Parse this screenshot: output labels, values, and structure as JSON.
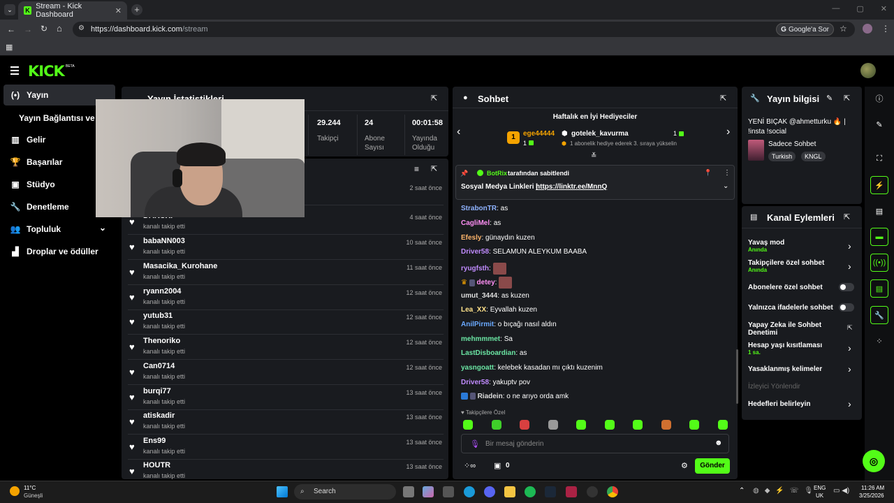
{
  "browser": {
    "tab_title": "Stream - Kick Dashboard",
    "url_host": "https://dashboard.kick.com",
    "url_path": "/stream",
    "google_label": "Google'a Sor"
  },
  "header": {
    "logo": "KICK",
    "beta": "BETA"
  },
  "sidebar": {
    "items": [
      {
        "label": "Yayın",
        "icon": "broadcast-icon"
      },
      {
        "label": "Yayın Bağlantısı ve Ar"
      },
      {
        "label": "Gelir",
        "icon": "chart-icon"
      },
      {
        "label": "Başarılar",
        "icon": "trophy-icon"
      },
      {
        "label": "Stüdyo",
        "icon": "studio-icon"
      },
      {
        "label": "Denetleme",
        "icon": "wrench-icon"
      },
      {
        "label": "Topluluk",
        "icon": "people-icon"
      },
      {
        "label": "Droplar ve ödüller",
        "icon": "gift-icon"
      }
    ]
  },
  "stats": {
    "title": "Yayın İstatistikleri",
    "items": [
      {
        "value": "29.244",
        "label": "Takipçi"
      },
      {
        "value": "24",
        "label": "Abone Sayısı"
      },
      {
        "value": "00:01:58",
        "label": "Yayında Olduğu"
      }
    ]
  },
  "followers": [
    {
      "name": "",
      "sub": "",
      "time": "2 saat önce"
    },
    {
      "name": "DAKUXI",
      "sub": "kanalı takip etti",
      "time": "4 saat önce"
    },
    {
      "name": "babaNN003",
      "sub": "kanalı takip etti",
      "time": "10 saat önce"
    },
    {
      "name": "Masacika_Kurohane",
      "sub": "kanalı takip etti",
      "time": "11 saat önce"
    },
    {
      "name": "ryann2004",
      "sub": "kanalı takip etti",
      "time": "12 saat önce"
    },
    {
      "name": "yutub31",
      "sub": "kanalı takip etti",
      "time": "12 saat önce"
    },
    {
      "name": "Thenoriko",
      "sub": "kanalı takip etti",
      "time": "12 saat önce"
    },
    {
      "name": "Can0714",
      "sub": "kanalı takip etti",
      "time": "12 saat önce"
    },
    {
      "name": "burqi77",
      "sub": "kanalı takip etti",
      "time": "13 saat önce"
    },
    {
      "name": "atiskadir",
      "sub": "kanalı takip etti",
      "time": "13 saat önce"
    },
    {
      "name": "Ens99",
      "sub": "kanalı takip etti",
      "time": "13 saat önce"
    },
    {
      "name": "HOUTR",
      "sub": "kanalı takip etti",
      "time": "13 saat önce"
    }
  ],
  "chat": {
    "title": "Sohbet",
    "gifters_title": "Haftalık en İyi Hediyeciler",
    "gifter1": "ege44444",
    "gifter1_count": "1",
    "gifter2": "gotelek_kavurma",
    "gifter2_count": "1",
    "gifter_note": "1 abonelik hediye ederek 3. sıraya yükselin",
    "pinned_by": "BotRix",
    "pinned_label": "tarafından sabitlendi",
    "pinned_text": "Sosyal Medya Linkleri | ",
    "pinned_link": "https://linktr.ee/MnnQ",
    "messages": [
      {
        "user": "StrabonTR",
        "color": "#8fb3ff",
        "text": "as"
      },
      {
        "user": "CagliMel",
        "color": "#ff8ff5",
        "text": "as"
      },
      {
        "user": "Efesly",
        "color": "#ffb56b",
        "text": "günaydın kuzen"
      },
      {
        "user": "Driver58",
        "color": "#c08bff",
        "text": "SELAMUN ALEYKUM BAABA"
      },
      {
        "user": "ryugfsth",
        "color": "#c08bff",
        "text": ""
      },
      {
        "user": "detey",
        "color": "#ff8ff5",
        "text": ""
      },
      {
        "user": "umut_3444",
        "color": "#dddddd",
        "text": "as kuzen"
      },
      {
        "user": "Lea_XX",
        "color": "#ffe28a",
        "text": "Eyvallah kuzen"
      },
      {
        "user": "AnilPirmit",
        "color": "#6aa9ff",
        "text": "o bıçağı nasıl aldın"
      },
      {
        "user": "mehmmmet",
        "color": "#6be6a4",
        "text": "Sa"
      },
      {
        "user": "LastDisboardian",
        "color": "#6be6a4",
        "text": "as"
      },
      {
        "user": "yasngoatt",
        "color": "#6be6a4",
        "text": "kelebek kasadan mı çıktı kuzenim"
      },
      {
        "user": "Driver58",
        "color": "#c08bff",
        "text": "yakuptv pov"
      },
      {
        "user": "Riadein",
        "color": "#dddddd",
        "text": "o ne arıyo orda amk"
      }
    ],
    "followers_only": "Takipçilere Özel",
    "input_placeholder": "Bir mesaj gönderin",
    "points": "0",
    "send_label": "Gönder"
  },
  "info": {
    "title": "Yayın bilgisi",
    "stream_title": "YENİ BIÇAK @ahmetturku 🔥 | !insta !social",
    "category": "Sadece Sohbet",
    "tags": [
      "Turkish",
      "KNGL"
    ]
  },
  "actions": {
    "title": "Kanal Eylemleri",
    "items": [
      {
        "label": "Yavaş mod",
        "sub": "Anında",
        "kind": "chevron"
      },
      {
        "label": "Takipçilere özel sohbet",
        "sub": "Anında",
        "kind": "chevron"
      },
      {
        "label": "Abonelere özel sohbet",
        "sub": "",
        "kind": "toggle"
      },
      {
        "label": "Yalnızca ifadelerle sohbet",
        "sub": "",
        "kind": "toggle"
      },
      {
        "label": "Yapay Zeka ile Sohbet Denetimi",
        "sub": "",
        "kind": "external"
      },
      {
        "label": "Hesap yaşı kısıtlaması",
        "sub": "1 sa.",
        "kind": "chevron"
      },
      {
        "label": "Yasaklanmış kelimeler",
        "sub": "",
        "kind": "chevron"
      },
      {
        "label": "İzleyici Yönlendir",
        "sub": "",
        "kind": "disabled"
      },
      {
        "label": "Hedefleri belirleyin",
        "sub": "",
        "kind": "chevron"
      }
    ]
  },
  "taskbar": {
    "weather_temp": "11°C",
    "weather_desc": "Güneşli",
    "search": "Search",
    "lang": "ENG",
    "region": "UK",
    "time": "11:26 AM",
    "date": "3/25/2026"
  },
  "colors": {
    "accent": "#53fc18",
    "panel": "#191b1f",
    "bg": "#000000"
  }
}
